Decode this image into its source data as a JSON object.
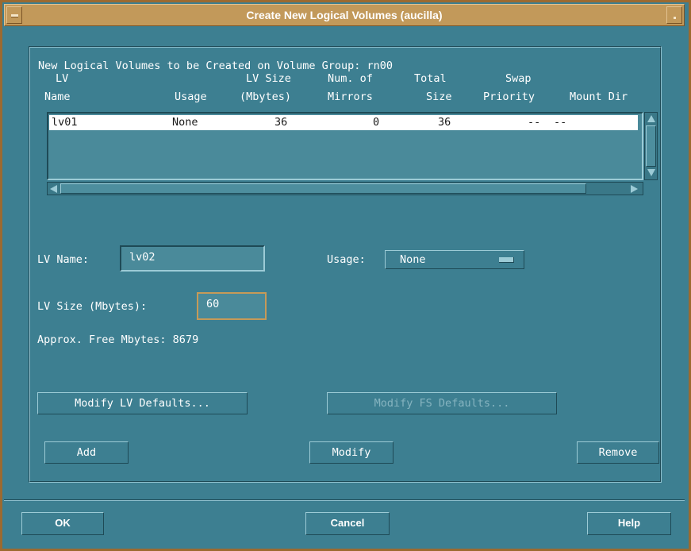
{
  "window": {
    "title": "Create New Logical Volumes (aucilla)"
  },
  "list": {
    "heading": "New Logical Volumes to be Created on Volume Group: rn00",
    "columns_line1": [
      "LV",
      "LV Size",
      "Num. of",
      "Total",
      "Swap",
      ""
    ],
    "columns_line2": [
      "Name",
      "Usage",
      "(Mbytes)",
      "Mirrors",
      "Size",
      "Priority",
      "Mount Dir"
    ],
    "rows": [
      {
        "name": "lv01",
        "usage": "None",
        "size": "36",
        "mirrors": "0",
        "total": "36",
        "swap": "--",
        "mount": "--"
      }
    ]
  },
  "form": {
    "lv_name_label": "LV Name:",
    "lv_name_value": "lv02",
    "usage_label": "Usage:",
    "usage_value": "None",
    "lv_size_label": "LV Size (Mbytes):",
    "lv_size_value": "60",
    "free_label": "Approx. Free Mbytes: 8679"
  },
  "buttons": {
    "modify_lv_defaults": "Modify LV Defaults...",
    "modify_fs_defaults": "Modify FS Defaults...",
    "add": "Add",
    "modify": "Modify",
    "remove": "Remove",
    "ok": "OK",
    "cancel": "Cancel",
    "help": "Help"
  },
  "colors": {
    "background": "#3d7f91",
    "titlebar": "#c2995a",
    "border": "#9c6a30"
  }
}
